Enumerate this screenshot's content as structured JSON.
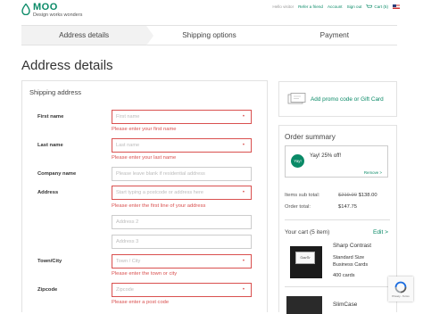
{
  "brand": {
    "name": "MOO",
    "tagline": "Design works wonders"
  },
  "topnav": {
    "greeting": "Hello visitor",
    "refer": "Refer a friend",
    "account": "Account",
    "signout": "Sign out",
    "cart": "Cart (5)"
  },
  "steps": [
    {
      "label": "Address details"
    },
    {
      "label": "Shipping options"
    },
    {
      "label": "Payment"
    }
  ],
  "page": {
    "title": "Address details"
  },
  "form": {
    "section_title": "Shipping address",
    "first_name": {
      "label": "First name",
      "placeholder": "First name",
      "error": "Please enter your first name"
    },
    "last_name": {
      "label": "Last name",
      "placeholder": "Last name",
      "error": "Please enter your last name"
    },
    "company": {
      "label": "Company name",
      "placeholder": "Please leave blank if residential address"
    },
    "address": {
      "label": "Address",
      "placeholder": "Start typing a postcode or address here",
      "line2_placeholder": "Address 2",
      "line3_placeholder": "Address 3",
      "error": "Please enter the first line of your address"
    },
    "town": {
      "label": "Town/City",
      "placeholder": "Town / City",
      "error": "Please enter the town or city"
    },
    "zip": {
      "label": "Zipcode",
      "placeholder": "Zipcode",
      "error": "Please enter a post code"
    }
  },
  "promo": {
    "label": "Add promo code or Gift Card"
  },
  "summary": {
    "title": "Order summary",
    "badge": "Yay!",
    "discount_text": "Yay! 25% off!",
    "remove": "Remove >",
    "items_sub_total_label": "Items sub total:",
    "items_sub_total_old": "$219.00",
    "items_sub_total_new": "$138.00",
    "order_total_label": "Order total:",
    "order_total_value": "$147.75",
    "cart_title": "Your cart (5 item)",
    "edit": "Edit >",
    "product1": {
      "name": "Sharp Contrast",
      "detail1": "Standard Size",
      "detail2": "Business Cards",
      "qty": "400 cards",
      "thumb_text": "Gazelle"
    },
    "product2": {
      "name": "SlimCase"
    }
  },
  "recaptcha": {
    "text": "Privacy - Terms"
  },
  "colors": {
    "accent": "#0a8a67",
    "error": "#d9504f"
  },
  "icons": [
    "moo-drop-icon",
    "cart-icon",
    "us-flag-icon",
    "promo-ticket-icon",
    "recaptcha-icon"
  ]
}
